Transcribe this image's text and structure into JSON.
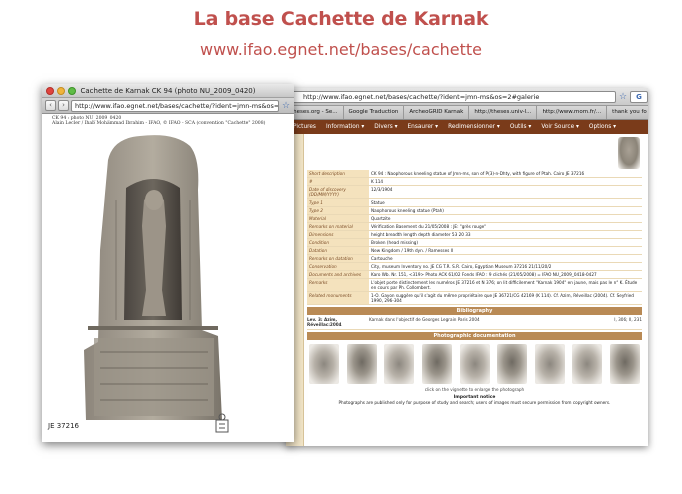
{
  "slide": {
    "title": "La base Cachette de Karnak",
    "url": "www.ifao.egnet.net/bases/cachette"
  },
  "colors": {
    "title": "#c0504d",
    "menu_bar": "#7a3b1a",
    "label_bg": "#f4e2bd",
    "section_bar": "#b98a55"
  },
  "back_window": {
    "url": "http://www.ifao.egnet.net/bases/cachette/?ident=jmn-ms&os=2#galerie",
    "search_icon": "google-icon",
    "bookmarks": [
      "theses.org - Se...",
      "Google Traduction",
      "ArcheoGRID Karnak",
      "http://theses.univ-l...",
      "http://www.mom.fr/...",
      "thank you fo"
    ],
    "menu": [
      "Pictures",
      "Information ▾",
      "Divers ▾",
      "Ensaurer ▾",
      "Redimensionner ▾",
      "Outils ▾",
      "Voir Source ▾",
      "Options ▾"
    ],
    "fields": [
      {
        "label": "Short description",
        "value": "CK 94 : Naophorous kneeling statue of Jmn-ms, son of P(3)-n-Dhty, with figure of Ptah. Cairo JE 37216"
      },
      {
        "label": "#",
        "value": "K 114"
      },
      {
        "label": "Date of discovery (DD/MM/YYYY)",
        "value": "12/3/1904"
      },
      {
        "label": "Type 1",
        "value": "Statue"
      },
      {
        "label": "Type 2",
        "value": "Naophorous kneeling statue (Ptah)"
      },
      {
        "label": "Material",
        "value": "Quartzite"
      },
      {
        "label": "Remarks on material",
        "value": "Vérification Basement du 21/05/2008 : JE: \"grès rouge\""
      },
      {
        "label": "Dimensions",
        "value": "height  breadth  length  depth  diameter  53  20  33"
      },
      {
        "label": "Condition",
        "value": "Broken (head missing)"
      },
      {
        "label": "Datation",
        "value": "New Kingdom / 19th dyn. / Ramesses II"
      },
      {
        "label": "Remarks on datation",
        "value": "Cartouche"
      },
      {
        "label": "Conservation",
        "value": "City, museum  Inventory no.  JE  CG  T.R.  S.R.  Cairo, Egyptian Museum  37216  21/11/20/2"
      },
      {
        "label": "Documents and archives",
        "value": "Karo Wb. Nr. 151, <319> Photo ACK 61/02 Fonds IFAO : 9 clichés (21/05/2008) = IFAO NU_2009_0418-0427"
      },
      {
        "label": "Remarks",
        "value": "L'objet porte distinctement les numéros JE 37216 et N 376; on lit difficilement \"Karnak 1904\" en jaune, mais pas le n° K. Étude en cours par Ph. Collombert."
      },
      {
        "label": "Related monuments",
        "value": "1-O. Gayon suggère qu'il s'agit du même propriétaire que JE 36721/CG 42169 (K 114). Cf. Azim, Réveillac (2004). Cf. Seyfried 1990, 296-304"
      }
    ],
    "bibliography_title": "Bibliography",
    "bibliography": [
      {
        "ref": "Lev. 3: Azim, Réveillac:2004",
        "text": "Karnak dans l'objectif de Georges Legrain Paris 2004",
        "pages": "I, 306; II, 231"
      }
    ],
    "photo_title": "Photographic documentation",
    "photo_caption": "click on the vignette to enlarge the photograph",
    "important_title": "Important notice",
    "important_text": "Photographs are published only for purpose of study and search; users of images must secure permission from copyright owners."
  },
  "front_window": {
    "title": "Cachette de Karnak CK 94 (photo NU_2009_0420)",
    "url": "http://www.ifao.egnet.net/bases/cachette/?ident=jmn-ms&os=2",
    "caption_1": "CK 94 : photo NU_2009_0420",
    "caption_2": "Alain Lecler / Ihab Mohammad Ibrahim - IFAO, © IFAO - SCA (convention \"Cachette\" 2008)",
    "je_ref": "JE 37216"
  }
}
